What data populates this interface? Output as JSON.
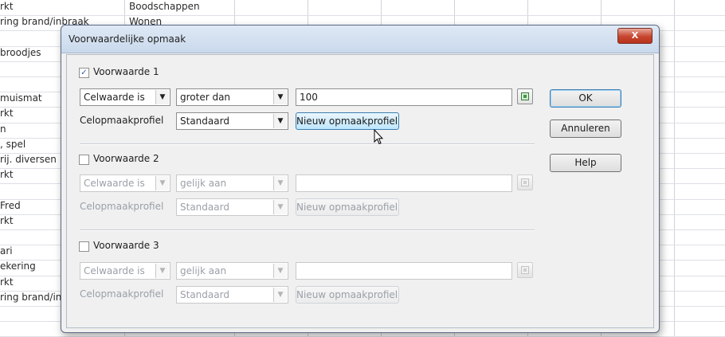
{
  "spreadsheet": {
    "col_a": [
      {
        "text": "rkt",
        "row": 0
      },
      {
        "text": "ring brand/inbraak",
        "row": 1
      },
      {
        "text": "broodjes",
        "row": 3
      },
      {
        "text": "muismat",
        "row": 6
      },
      {
        "text": "rkt",
        "row": 7
      },
      {
        "text": "n",
        "row": 8
      },
      {
        "text": ", spel",
        "row": 9
      },
      {
        "text": "rij. diversen",
        "row": 10
      },
      {
        "text": "rkt",
        "row": 11
      },
      {
        "text": "Fred",
        "row": 13
      },
      {
        "text": "rkt",
        "row": 14
      },
      {
        "text": "ari",
        "row": 16
      },
      {
        "text": "ekering",
        "row": 17
      },
      {
        "text": "rkt",
        "row": 18
      },
      {
        "text": "ring brand/inbraak",
        "row": 19
      }
    ],
    "col_b": [
      {
        "text": "Boodschappen",
        "row": 0
      },
      {
        "text": "Wonen",
        "row": 1
      }
    ]
  },
  "dialog": {
    "title": "Voorwaardelijke opmaak",
    "close_label": "X",
    "ok_label": "OK",
    "cancel_label": "Annuleren",
    "help_label": "Help",
    "conditions": [
      {
        "checkbox_label": "Voorwaarde 1",
        "checked": true,
        "enabled": true,
        "mode": "Celwaarde is",
        "operator": "groter dan",
        "value": "100",
        "style_label": "Celopmaakprofiel",
        "style": "Standaard",
        "new_style_label": "Nieuw opmaakprofiel"
      },
      {
        "checkbox_label": "Voorwaarde 2",
        "checked": false,
        "enabled": false,
        "mode": "Celwaarde is",
        "operator": "gelijk aan",
        "value": "",
        "style_label": "Celopmaakprofiel",
        "style": "Standaard",
        "new_style_label": "Nieuw opmaakprofiel"
      },
      {
        "checkbox_label": "Voorwaarde 3",
        "checked": false,
        "enabled": false,
        "mode": "Celwaarde is",
        "operator": "gelijk aan",
        "value": "",
        "style_label": "Celopmaakprofiel",
        "style": "Standaard",
        "new_style_label": "Nieuw opmaakprofiel"
      }
    ]
  },
  "icons": {
    "checkbox_checked": "checkmark-icon",
    "dropdown": "chevron-down-icon",
    "shrink": "shrink-range-icon",
    "close": "close-icon",
    "cursor": "mouse-pointer-icon"
  }
}
